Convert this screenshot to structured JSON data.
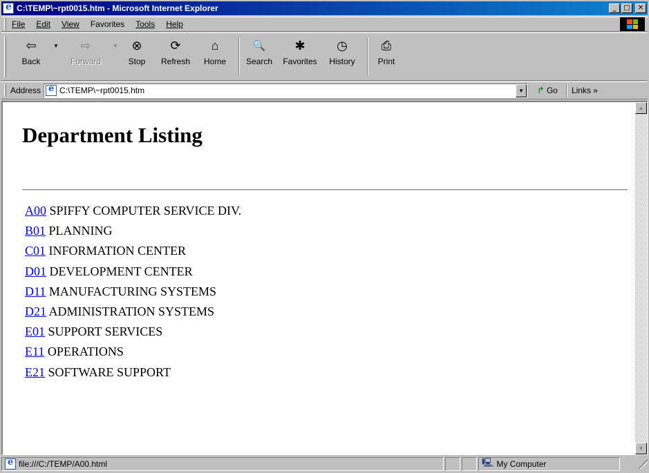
{
  "window": {
    "title": "C:\\TEMP\\~rpt0015.htm - Microsoft Internet Explorer",
    "minimize_glyph": "_",
    "maximize_glyph": "□",
    "close_glyph": "✕"
  },
  "menu": {
    "items": [
      {
        "label": "File"
      },
      {
        "label": "Edit"
      },
      {
        "label": "View"
      },
      {
        "label": "Favorites"
      },
      {
        "label": "Tools"
      },
      {
        "label": "Help"
      }
    ]
  },
  "toolbar": {
    "back": {
      "label": "Back",
      "icon": "back-arrow-icon",
      "glyph": "⇦"
    },
    "forward": {
      "label": "Forward",
      "icon": "forward-arrow-icon",
      "glyph": "⇨"
    },
    "stop": {
      "label": "Stop",
      "icon": "stop-icon",
      "glyph": "⊗"
    },
    "refresh": {
      "label": "Refresh",
      "icon": "refresh-icon",
      "glyph": "⟳"
    },
    "home": {
      "label": "Home",
      "icon": "home-icon",
      "glyph": "⌂"
    },
    "search": {
      "label": "Search",
      "icon": "search-icon",
      "glyph": "🔍"
    },
    "favorites": {
      "label": "Favorites",
      "icon": "favorites-icon",
      "glyph": "✱"
    },
    "history": {
      "label": "History",
      "icon": "history-icon",
      "glyph": "◷"
    },
    "print": {
      "label": "Print",
      "icon": "print-icon",
      "glyph": "⎙"
    }
  },
  "address": {
    "label": "Address",
    "url": "C:\\TEMP\\~rpt0015.htm",
    "go_label": "Go",
    "links_label": "Links »"
  },
  "page": {
    "heading": "Department Listing",
    "departments": [
      {
        "code": "A00",
        "name": "SPIFFY COMPUTER SERVICE DIV."
      },
      {
        "code": "B01",
        "name": "PLANNING"
      },
      {
        "code": "C01",
        "name": "INFORMATION CENTER"
      },
      {
        "code": "D01",
        "name": "DEVELOPMENT CENTER"
      },
      {
        "code": "D11",
        "name": "MANUFACTURING SYSTEMS"
      },
      {
        "code": "D21",
        "name": "ADMINISTRATION SYSTEMS"
      },
      {
        "code": "E01",
        "name": "SUPPORT SERVICES"
      },
      {
        "code": "E11",
        "name": "OPERATIONS"
      },
      {
        "code": "E21",
        "name": "SOFTWARE SUPPORT"
      }
    ]
  },
  "status": {
    "text": "file:///C:/TEMP/A00.html",
    "zone": "My Computer"
  },
  "colors": {
    "link": "#0000ee",
    "titlebar": "#000080",
    "chrome": "#c0c0c0"
  }
}
